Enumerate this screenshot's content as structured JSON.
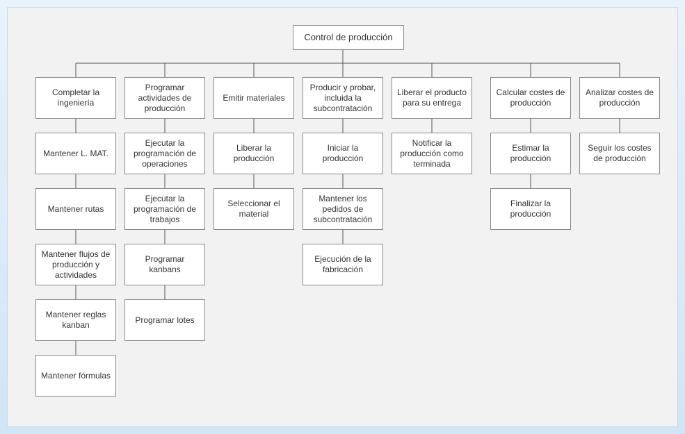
{
  "root": {
    "label": "Control de producción"
  },
  "columns": [
    {
      "head": "Completar\nla ingeniería",
      "items": [
        "Mantener L. MAT.",
        "Mantener rutas",
        "Mantener flujos de producción y actividades",
        "Mantener reglas kanban",
        "Mantener fórmulas"
      ]
    },
    {
      "head": "Programar actividades de producción",
      "items": [
        "Ejecutar la programación de operaciones",
        "Ejecutar la programación de trabajos",
        "Programar kanbans",
        "Programar lotes"
      ]
    },
    {
      "head": "Emitir materiales",
      "items": [
        "Liberar la producción",
        "Seleccionar el material"
      ]
    },
    {
      "head": "Producir y probar, incluida la subcontratación",
      "items": [
        "Iniciar la producción",
        "Mantener los pedidos de subcontratación",
        "Ejecución de la fabricación"
      ]
    },
    {
      "head": "Liberar el producto para su entrega",
      "items": [
        "Notificar la producción como terminada"
      ]
    },
    {
      "head": "Calcular costes de producción",
      "items": [
        "Estimar la producción",
        "Finalizar la producción"
      ]
    },
    {
      "head": "Analizar costes de producción",
      "items": [
        "Seguir los costes de producción"
      ]
    }
  ]
}
